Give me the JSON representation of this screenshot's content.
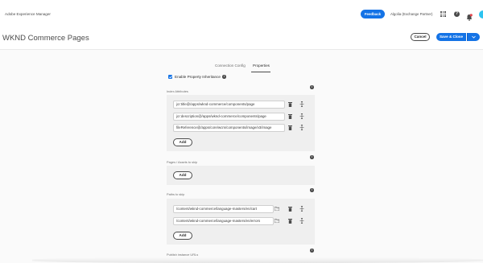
{
  "shell": {
    "app_title": "Adobe Experience Manager",
    "feedback_label": "Feedback",
    "org_label": "Algolia (Exchange Partner)",
    "help_label": "?"
  },
  "header": {
    "page_title": "WKND Commerce Pages",
    "cancel_label": "Cancel",
    "save_label": "Save & Close"
  },
  "tabs": [
    {
      "label": "Connection Config",
      "active": false
    },
    {
      "label": "Properties",
      "active": true
    }
  ],
  "form": {
    "enable_inheritance_label": "Enable Property Inheritance",
    "enable_inheritance_checked": true,
    "index_attributes": {
      "label": "Index Attributes",
      "values": [
        "jcr:title@/apps/wknd-commerce/components/page",
        "jcr:description@/apps/wknd-commerce/components/page",
        "fileReference@/apps/core/wcm/components/image/v3/image"
      ],
      "add_label": "Add"
    },
    "pages_to_skip": {
      "label": "Pages / Assets to skip",
      "add_label": "Add"
    },
    "paths_to_skip": {
      "label": "Paths to skip",
      "values": [
        "/content/wknd-commerce/language-masters/en/cart",
        "/content/wknd-commerce/language-masters/en/errors"
      ],
      "add_label": "Add"
    },
    "publish_urls": {
      "label": "Publish instance URLs"
    },
    "info_glyph": "i"
  },
  "colors": {
    "accent": "#1473e6",
    "avatar": "#2dc3f0",
    "notification": "#e34850"
  },
  "icons": [
    "grid-icon",
    "help-icon",
    "bell-icon",
    "chevron-down-icon",
    "info-icon",
    "trash-icon",
    "move-icon",
    "folder-icon",
    "check-icon"
  ]
}
